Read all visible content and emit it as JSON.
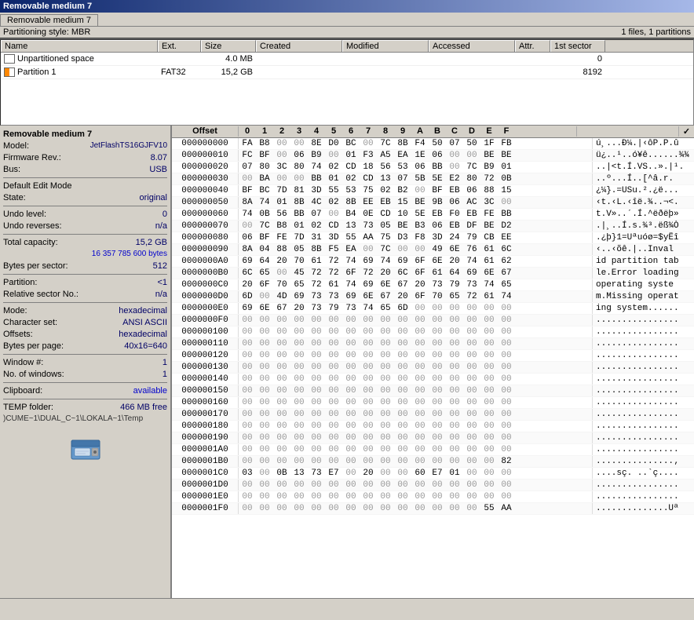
{
  "window": {
    "title": "Removable medium 7",
    "tab_label": "Removable medium 7"
  },
  "status_bar": {
    "style_label": "Partitioning style: MBR",
    "file_info": "1 files, 1 partitions"
  },
  "columns": {
    "name": "Name",
    "ext": "Ext.",
    "size": "Size",
    "created": "Created",
    "modified": "Modified",
    "accessed": "Accessed",
    "attr": "Attr.",
    "first_sector": "1st sector"
  },
  "files": [
    {
      "name": "Unpartitioned space",
      "ext": "",
      "size": "4.0 MB",
      "created": "",
      "modified": "",
      "accessed": "",
      "attr": "",
      "first_sector": "0",
      "icon": "unpart"
    },
    {
      "name": "Partition 1",
      "ext": "FAT32",
      "size": "15,2 GB",
      "created": "",
      "modified": "",
      "accessed": "",
      "attr": "",
      "first_sector": "8192",
      "icon": "partition"
    }
  ],
  "left_panel": {
    "device_label": "Removable medium 7",
    "model_label": "Model:",
    "model_value": "JetFlashTS16GJFV10",
    "firmware_label": "Firmware Rev.:",
    "firmware_value": "8.07",
    "bus_label": "Bus:",
    "bus_value": "USB",
    "edit_mode_label": "Default Edit Mode",
    "state_label": "State:",
    "state_value": "original",
    "undo_level_label": "Undo level:",
    "undo_level_value": "0",
    "undo_reverses_label": "Undo reverses:",
    "undo_reverses_value": "n/a",
    "total_cap_label": "Total capacity:",
    "total_cap_value": "15,2 GB",
    "total_cap_bytes": "16 357 785 600 bytes",
    "bytes_per_sector_label": "Bytes per sector:",
    "bytes_per_sector_value": "512",
    "partition_label": "Partition:",
    "partition_value": "<1",
    "relative_sector_label": "Relative sector No.:",
    "relative_sector_value": "n/a",
    "mode_label": "Mode:",
    "mode_value": "hexadecimal",
    "charset_label": "Character set:",
    "charset_value": "ANSI ASCII",
    "offsets_label": "Offsets:",
    "offsets_value": "hexadecimal",
    "bytes_per_page_label": "Bytes per page:",
    "bytes_per_page_value": "40x16=640",
    "window_num_label": "Window #:",
    "window_num_value": "1",
    "no_windows_label": "No. of windows:",
    "no_windows_value": "1",
    "clipboard_label": "Clipboard:",
    "clipboard_value": "available",
    "temp_folder_label": "TEMP folder:",
    "temp_folder_value": "466 MB free",
    "temp_folder_path": ")CUME~1\\DUAL_C~1\\LOKALA~1\\Temp"
  },
  "hex_header": {
    "offset_label": "Offset",
    "cols": [
      "0",
      "1",
      "2",
      "3",
      "4",
      "5",
      "6",
      "7",
      "8",
      "9",
      "A",
      "B",
      "C",
      "D",
      "E",
      "F"
    ],
    "checkmark": "✓"
  },
  "hex_rows": [
    {
      "offset": "000000000",
      "bytes": [
        "FA",
        "B8",
        "00",
        "00",
        "8E",
        "D0",
        "BC",
        "00",
        "7C",
        "8B",
        "F4",
        "50",
        "07",
        "50",
        "1F",
        "FB"
      ],
      "ascii": "ú¸...Đ¼.|‹ôP.P.û"
    },
    {
      "offset": "000000010",
      "bytes": [
        "FC",
        "BF",
        "00",
        "06",
        "B9",
        "00",
        "01",
        "F3",
        "A5",
        "EA",
        "1E",
        "06",
        "00",
        "00",
        "BE",
        "BE"
      ],
      "ascii": "ü¿..¹..ó¥ê......¾¾"
    },
    {
      "offset": "000000020",
      "bytes": [
        "07",
        "80",
        "3C",
        "80",
        "74",
        "02",
        "CD",
        "18",
        "56",
        "53",
        "06",
        "BB",
        "00",
        "7C",
        "B9",
        "01"
      ],
      "ascii": "..|<t.Í.VS..».|¹."
    },
    {
      "offset": "000000030",
      "bytes": [
        "00",
        "BA",
        "00",
        "00",
        "BB",
        "01",
        "02",
        "CD",
        "13",
        "07",
        "5B",
        "5E",
        "E2",
        "80",
        "72",
        "0B"
      ],
      "ascii": "..º...Í..[^â.r."
    },
    {
      "offset": "000000040",
      "bytes": [
        "BF",
        "BC",
        "7D",
        "81",
        "3D",
        "55",
        "53",
        "75",
        "02",
        "B2",
        "00",
        "BF",
        "EB",
        "06",
        "88",
        "15"
      ],
      "ascii": "¿¼}.=USu.².¿ë..."
    },
    {
      "offset": "000000050",
      "bytes": [
        "8A",
        "74",
        "01",
        "8B",
        "4C",
        "02",
        "8B",
        "EE",
        "EB",
        "15",
        "BE",
        "9B",
        "06",
        "AC",
        "3C",
        "00"
      ],
      "ascii": "‹t.‹L.‹îë.¾..¬<."
    },
    {
      "offset": "000000060",
      "bytes": [
        "74",
        "0B",
        "56",
        "BB",
        "07",
        "00",
        "B4",
        "0E",
        "CD",
        "10",
        "5E",
        "EB",
        "F0",
        "EB",
        "FE",
        "BB"
      ],
      "ascii": "t.V»..´.Í.^ëðëþ»"
    },
    {
      "offset": "000000070",
      "bytes": [
        "00",
        "7C",
        "B8",
        "01",
        "02",
        "CD",
        "13",
        "73",
        "05",
        "BE",
        "B3",
        "06",
        "EB",
        "DF",
        "BE",
        "D2"
      ],
      "ascii": ".|¸..Í.s.¾³.ëß¾Ò"
    },
    {
      "offset": "000000080",
      "bytes": [
        "06",
        "BF",
        "FE",
        "7D",
        "31",
        "3D",
        "55",
        "AA",
        "75",
        "D3",
        "F8",
        "3D",
        "24",
        "79",
        "CB",
        "EE"
      ],
      "ascii": ".¿þ}1=Uªuóø=$yËî"
    },
    {
      "offset": "000000090",
      "bytes": [
        "8A",
        "04",
        "88",
        "05",
        "8B",
        "F5",
        "EA",
        "00",
        "7C",
        "00",
        "00",
        "49",
        "6E",
        "76",
        "61",
        "6C"
      ],
      "ascii": "‹..‹õê.|..Inval"
    },
    {
      "offset": "0000000A0",
      "bytes": [
        "69",
        "64",
        "20",
        "70",
        "61",
        "72",
        "74",
        "69",
        "74",
        "69",
        "6F",
        "6E",
        "20",
        "74",
        "61",
        "62"
      ],
      "ascii": "id partition tab"
    },
    {
      "offset": "0000000B0",
      "bytes": [
        "6C",
        "65",
        "00",
        "45",
        "72",
        "72",
        "6F",
        "72",
        "20",
        "6C",
        "6F",
        "61",
        "64",
        "69",
        "6E",
        "67"
      ],
      "ascii": "le.Error loading"
    },
    {
      "offset": "0000000C0",
      "bytes": [
        "20",
        "6F",
        "70",
        "65",
        "72",
        "61",
        "74",
        "69",
        "6E",
        "67",
        "20",
        "73",
        "79",
        "73",
        "74",
        "65"
      ],
      "ascii": " operating syste"
    },
    {
      "offset": "0000000D0",
      "bytes": [
        "6D",
        "00",
        "4D",
        "69",
        "73",
        "73",
        "69",
        "6E",
        "67",
        "20",
        "6F",
        "70",
        "65",
        "72",
        "61",
        "74"
      ],
      "ascii": "m.Missing operat"
    },
    {
      "offset": "0000000E0",
      "bytes": [
        "69",
        "6E",
        "67",
        "20",
        "73",
        "79",
        "73",
        "74",
        "65",
        "6D",
        "00",
        "00",
        "00",
        "00",
        "00",
        "00"
      ],
      "ascii": "ing system......"
    },
    {
      "offset": "0000000F0",
      "bytes": [
        "00",
        "00",
        "00",
        "00",
        "00",
        "00",
        "00",
        "00",
        "00",
        "00",
        "00",
        "00",
        "00",
        "00",
        "00",
        "00"
      ],
      "ascii": "................"
    },
    {
      "offset": "000000100",
      "bytes": [
        "00",
        "00",
        "00",
        "00",
        "00",
        "00",
        "00",
        "00",
        "00",
        "00",
        "00",
        "00",
        "00",
        "00",
        "00",
        "00"
      ],
      "ascii": "................"
    },
    {
      "offset": "000000110",
      "bytes": [
        "00",
        "00",
        "00",
        "00",
        "00",
        "00",
        "00",
        "00",
        "00",
        "00",
        "00",
        "00",
        "00",
        "00",
        "00",
        "00"
      ],
      "ascii": "................"
    },
    {
      "offset": "000000120",
      "bytes": [
        "00",
        "00",
        "00",
        "00",
        "00",
        "00",
        "00",
        "00",
        "00",
        "00",
        "00",
        "00",
        "00",
        "00",
        "00",
        "00"
      ],
      "ascii": "................"
    },
    {
      "offset": "000000130",
      "bytes": [
        "00",
        "00",
        "00",
        "00",
        "00",
        "00",
        "00",
        "00",
        "00",
        "00",
        "00",
        "00",
        "00",
        "00",
        "00",
        "00"
      ],
      "ascii": "................"
    },
    {
      "offset": "000000140",
      "bytes": [
        "00",
        "00",
        "00",
        "00",
        "00",
        "00",
        "00",
        "00",
        "00",
        "00",
        "00",
        "00",
        "00",
        "00",
        "00",
        "00"
      ],
      "ascii": "................"
    },
    {
      "offset": "000000150",
      "bytes": [
        "00",
        "00",
        "00",
        "00",
        "00",
        "00",
        "00",
        "00",
        "00",
        "00",
        "00",
        "00",
        "00",
        "00",
        "00",
        "00"
      ],
      "ascii": "................"
    },
    {
      "offset": "000000160",
      "bytes": [
        "00",
        "00",
        "00",
        "00",
        "00",
        "00",
        "00",
        "00",
        "00",
        "00",
        "00",
        "00",
        "00",
        "00",
        "00",
        "00"
      ],
      "ascii": "................"
    },
    {
      "offset": "000000170",
      "bytes": [
        "00",
        "00",
        "00",
        "00",
        "00",
        "00",
        "00",
        "00",
        "00",
        "00",
        "00",
        "00",
        "00",
        "00",
        "00",
        "00"
      ],
      "ascii": "................"
    },
    {
      "offset": "000000180",
      "bytes": [
        "00",
        "00",
        "00",
        "00",
        "00",
        "00",
        "00",
        "00",
        "00",
        "00",
        "00",
        "00",
        "00",
        "00",
        "00",
        "00"
      ],
      "ascii": "................"
    },
    {
      "offset": "000000190",
      "bytes": [
        "00",
        "00",
        "00",
        "00",
        "00",
        "00",
        "00",
        "00",
        "00",
        "00",
        "00",
        "00",
        "00",
        "00",
        "00",
        "00"
      ],
      "ascii": "................"
    },
    {
      "offset": "0000001A0",
      "bytes": [
        "00",
        "00",
        "00",
        "00",
        "00",
        "00",
        "00",
        "00",
        "00",
        "00",
        "00",
        "00",
        "00",
        "00",
        "00",
        "00"
      ],
      "ascii": "................"
    },
    {
      "offset": "0000001B0",
      "bytes": [
        "00",
        "00",
        "00",
        "00",
        "00",
        "00",
        "00",
        "00",
        "00",
        "00",
        "00",
        "00",
        "00",
        "00",
        "00",
        "82"
      ],
      "ascii": "...............‚"
    },
    {
      "offset": "0000001C0",
      "bytes": [
        "03",
        "00",
        "0B",
        "13",
        "73",
        "E7",
        "00",
        "20",
        "00",
        "00",
        "60",
        "E7",
        "01",
        "00",
        "00",
        "00"
      ],
      "ascii": "....sç. ..`ç...."
    },
    {
      "offset": "0000001D0",
      "bytes": [
        "00",
        "00",
        "00",
        "00",
        "00",
        "00",
        "00",
        "00",
        "00",
        "00",
        "00",
        "00",
        "00",
        "00",
        "00",
        "00"
      ],
      "ascii": "................"
    },
    {
      "offset": "0000001E0",
      "bytes": [
        "00",
        "00",
        "00",
        "00",
        "00",
        "00",
        "00",
        "00",
        "00",
        "00",
        "00",
        "00",
        "00",
        "00",
        "00",
        "00"
      ],
      "ascii": "................"
    },
    {
      "offset": "0000001F0",
      "bytes": [
        "00",
        "00",
        "00",
        "00",
        "00",
        "00",
        "00",
        "00",
        "00",
        "00",
        "00",
        "00",
        "00",
        "00",
        "55",
        "AA"
      ],
      "ascii": "..............Uª"
    }
  ]
}
